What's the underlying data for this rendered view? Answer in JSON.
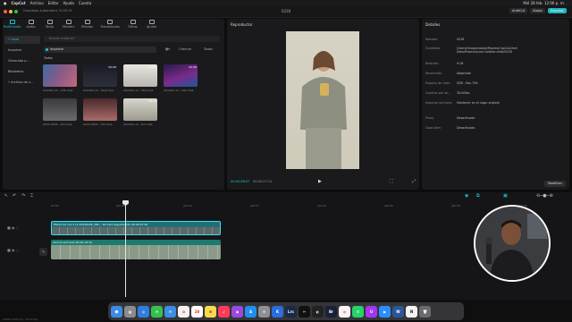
{
  "menubar": {
    "app": "CapCut",
    "items": [
      "Archivo",
      "Editar",
      "Ayuda",
      "Cuenta"
    ],
    "clock": "Mié 28 feb. 12:06 p. m."
  },
  "titlebar": {
    "project": "Guardado automático 12:05:51",
    "title": "0228",
    "account": "AnteCut",
    "shortcut": "Atajos",
    "export": "Exportar"
  },
  "media_tabs": [
    {
      "label": "Multimedia",
      "icon": "media-icon",
      "active": true
    },
    {
      "label": "Audio",
      "icon": "audio-icon",
      "active": false
    },
    {
      "label": "Texto",
      "icon": "text-icon",
      "active": false
    },
    {
      "label": "Stickers",
      "icon": "sticker-icon",
      "active": false
    },
    {
      "label": "Efectos",
      "icon": "effects-icon",
      "active": false
    },
    {
      "label": "Transiciones",
      "icon": "transition-icon",
      "active": false
    },
    {
      "label": "Filtros",
      "icon": "filter-icon",
      "active": false
    },
    {
      "label": "Ajuste",
      "icon": "adjust-icon",
      "active": false
    }
  ],
  "sidebar": {
    "items": [
      {
        "label": "• Local",
        "active": true
      },
      {
        "label": "Importar",
        "active": false
      },
      {
        "label": "Generado p...",
        "active": false
      },
      {
        "label": "Biblioteca",
        "active": false
      },
      {
        "label": "• Archivo de n...",
        "active": false
      }
    ]
  },
  "media": {
    "search_placeholder": "Buscar material",
    "import_label": "Importar",
    "sort_label": "Ordenar",
    "filter_label": "Todos",
    "section_label": "Todos",
    "items": [
      {
        "label": "Añadido ari...2db.mp4",
        "duration": ""
      },
      {
        "label": "Añadido ari...0eja.mp4",
        "duration": "00:06"
      },
      {
        "label": "Añadido ari...9fdj.mp4",
        "duration": "00:08"
      },
      {
        "label": "Añadido ari...2db.mp4",
        "duration": "00:08"
      },
      {
        "label": "2024 0228...123.mp4",
        "duration": ""
      },
      {
        "label": "2024 0228...7d2.mp4",
        "duration": ""
      },
      {
        "label": "Añadido ari...f22.mp4",
        "duration": "00:05"
      }
    ]
  },
  "player": {
    "title": "Reproductor",
    "current_time": "00:00:08:07",
    "total_time": "00:00:27:11"
  },
  "details": {
    "title": "Detalles",
    "rows": [
      {
        "label": "Nombre:",
        "value": "0228"
      },
      {
        "label": "Guardado:",
        "value": "/Users/tinaparrabaja/Movies/CapCut/User Data/Projects/com.lveditor.draft/0228"
      },
      {
        "label": "Relación:",
        "value": "9:16"
      },
      {
        "label": "Resolución:",
        "value": "Adaptado"
      },
      {
        "label": "Espacio de color:",
        "value": "SDR - Rec.709"
      },
      {
        "label": "Cuadros por se...",
        "value": "30.00fps"
      },
      {
        "label": "Importar archivos:",
        "value": "Mantener en el lugar original"
      },
      {
        "label": "Proxy:",
        "value": "Desactivado"
      },
      {
        "label": "Capa libre:",
        "value": "Desactivado"
      }
    ],
    "modify_label": "Modificar"
  },
  "timeline": {
    "ticks": [
      "00:00",
      "|00:05",
      "|00:10",
      "|00:15",
      "|00:20",
      "|00:25",
      "|00:30",
      "|00:35"
    ],
    "video_clip_label": "Efecto de voz 2 Ls  20240228_182... 4K.mp4   Seguimiento  00:00:07:20",
    "audio_clip_label": "Alarma  animado  00:00:19:10"
  },
  "status": {
    "left": "1080×1920 px  |  30.00 fps"
  },
  "dock": [
    "Finder",
    "Launchpad",
    "Safari",
    "Mensajes",
    "Mail",
    "Fotos",
    "Calendario",
    "Notas",
    "Música",
    "Podcasts",
    "App Store",
    "Ajustes",
    "Keynote",
    "Lrc",
    "CapCut",
    "Figma",
    "Br",
    "Chrome",
    "WhatsApp",
    "Udemy",
    "Zoom",
    "Word",
    "Notion",
    "Papelera"
  ]
}
